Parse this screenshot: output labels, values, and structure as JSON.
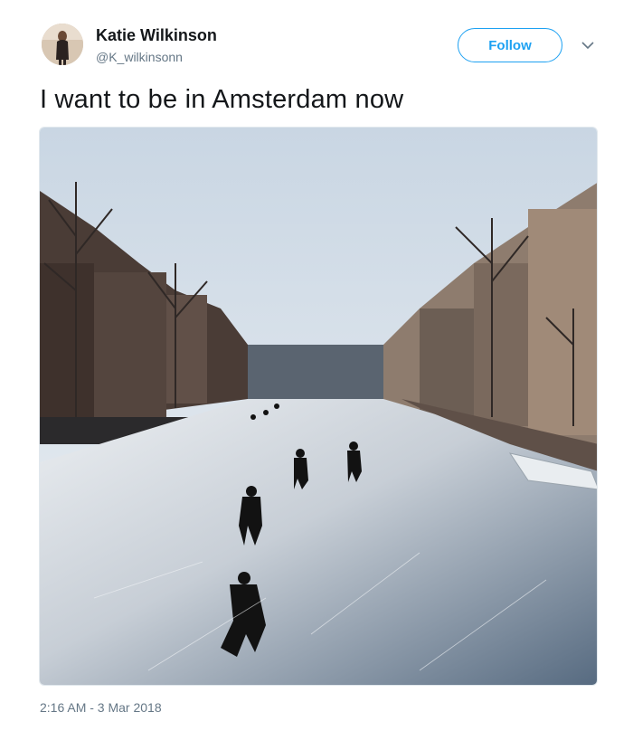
{
  "tweet": {
    "author_name": "Katie Wilkinson",
    "author_handle": "@K_wilkinsonn",
    "follow_label": "Follow",
    "text": "I want to be in Amsterdam now",
    "timestamp": "2:16 AM - 3 Mar 2018"
  },
  "icons": {
    "caret": "chevron-down-icon",
    "avatar": "avatar"
  },
  "colors": {
    "accent": "#1da1f2",
    "text": "#14171a",
    "muted": "#657786"
  }
}
